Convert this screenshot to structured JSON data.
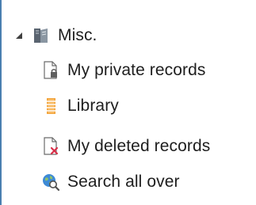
{
  "tree": {
    "parent": {
      "label": "Misc.",
      "expanded": true,
      "icon": "misc-folder-icon",
      "expander_icon": "expanded-triangle-icon"
    },
    "children": [
      {
        "label": "My private records",
        "icon": "private-document-lock-icon"
      },
      {
        "label": "Library",
        "icon": "library-books-icon"
      },
      {
        "label": "My deleted records",
        "icon": "deleted-document-x-icon"
      },
      {
        "label": "Search all over",
        "icon": "globe-search-icon"
      }
    ]
  },
  "colors": {
    "text": "#1e1e1e",
    "left_border": "#4a7fb0",
    "library_orange": "#f2a33a",
    "delete_red": "#d9304a",
    "globe_blue": "#3e8ad6"
  }
}
